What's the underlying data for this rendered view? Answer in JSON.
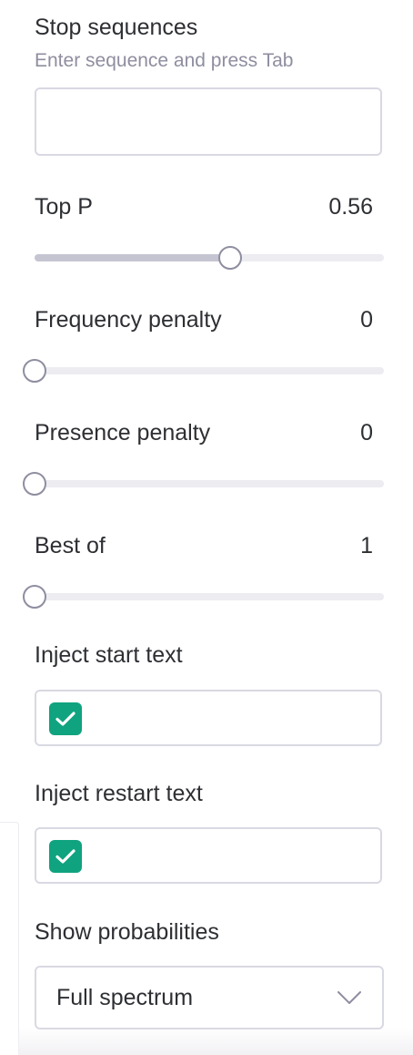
{
  "stop_sequences": {
    "label": "Stop sequences",
    "hint": "Enter sequence and press Tab",
    "value": ""
  },
  "top_p": {
    "label": "Top P",
    "value": "0.56",
    "level": 0.56
  },
  "frequency_penalty": {
    "label": "Frequency penalty",
    "value": "0",
    "level": 0
  },
  "presence_penalty": {
    "label": "Presence penalty",
    "value": "0",
    "level": 0
  },
  "best_of": {
    "label": "Best of",
    "value": "1",
    "level": 0
  },
  "inject_start_text": {
    "label": "Inject start text",
    "checked": true
  },
  "inject_restart_text": {
    "label": "Inject restart text",
    "checked": true
  },
  "show_probabilities": {
    "label": "Show probabilities",
    "selected": "Full spectrum"
  },
  "colors": {
    "accent": "#10a37f",
    "border": "#d9d9e3",
    "track": "#ececf1",
    "track_fill": "#c5c5d2",
    "hint_text": "#8e8ea0"
  },
  "icons": {
    "checkbox": "check-icon",
    "select": "chevron-down-icon"
  }
}
